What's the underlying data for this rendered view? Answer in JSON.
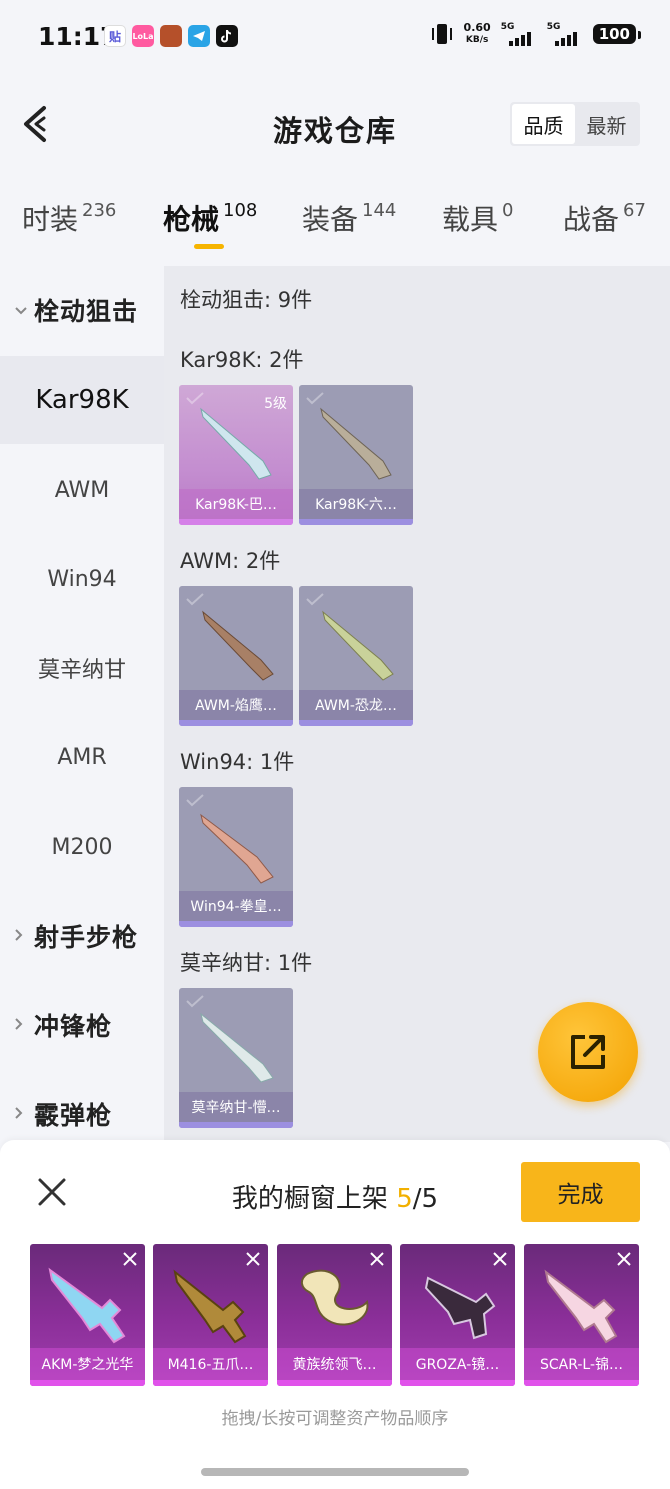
{
  "status_bar": {
    "time": "11:17",
    "apps": [
      "贴",
      "LoLa",
      "",
      "",
      ""
    ],
    "app_colors": [
      "#ffffff",
      "#ff5aa0",
      "#b5502a",
      "#2aa4e6",
      "#111111"
    ],
    "speed_value": "0.60",
    "speed_unit": "KB/s",
    "net1": "5G",
    "net2": "5G",
    "battery": "100"
  },
  "header": {
    "title": "游戏仓库",
    "sort_options": [
      "品质",
      "最新"
    ]
  },
  "tabs": [
    {
      "label": "时装",
      "count": "236"
    },
    {
      "label": "枪械",
      "count": "108"
    },
    {
      "label": "装备",
      "count": "144"
    },
    {
      "label": "载具",
      "count": "0"
    },
    {
      "label": "战备",
      "count": "67"
    }
  ],
  "sidebar": {
    "group_open": "栓动狙击",
    "items": [
      "Kar98K",
      "AWM",
      "Win94",
      "莫辛纳甘",
      "AMR",
      "M200"
    ],
    "groups_closed": [
      "射手步枪",
      "冲锋枪",
      "霰弹枪"
    ]
  },
  "main": {
    "group_heading": "栓动狙击: 9件",
    "sections": [
      {
        "heading": "Kar98K: 2件",
        "cards": [
          {
            "name": "Kar98K-巴…",
            "level": "5级"
          },
          {
            "name": "Kar98K-六…"
          }
        ]
      },
      {
        "heading": "AWM: 2件",
        "cards": [
          {
            "name": "AWM-焰鹰…"
          },
          {
            "name": "AWM-恐龙…"
          }
        ]
      },
      {
        "heading": "Win94: 1件",
        "cards": [
          {
            "name": "Win94-拳皇…"
          }
        ]
      },
      {
        "heading": "莫辛纳甘: 1件",
        "cards": [
          {
            "name": "莫辛纳甘-懵…"
          }
        ]
      }
    ]
  },
  "sheet": {
    "title_prefix": "我的橱窗上架",
    "count_current": "5",
    "count_sep_total": "/5",
    "done_label": "完成",
    "slots": [
      "AKM-梦之光华",
      "M416-五爪…",
      "黄族统领飞…",
      "GROZA-镜…",
      "SCAR-L-锦…"
    ],
    "hint": "拖拽/长按可调整资产物品顺序"
  },
  "colors": {
    "accent": "#f6b400",
    "button": "#f8b51a",
    "legendary_purple": "#8c2f9a"
  }
}
